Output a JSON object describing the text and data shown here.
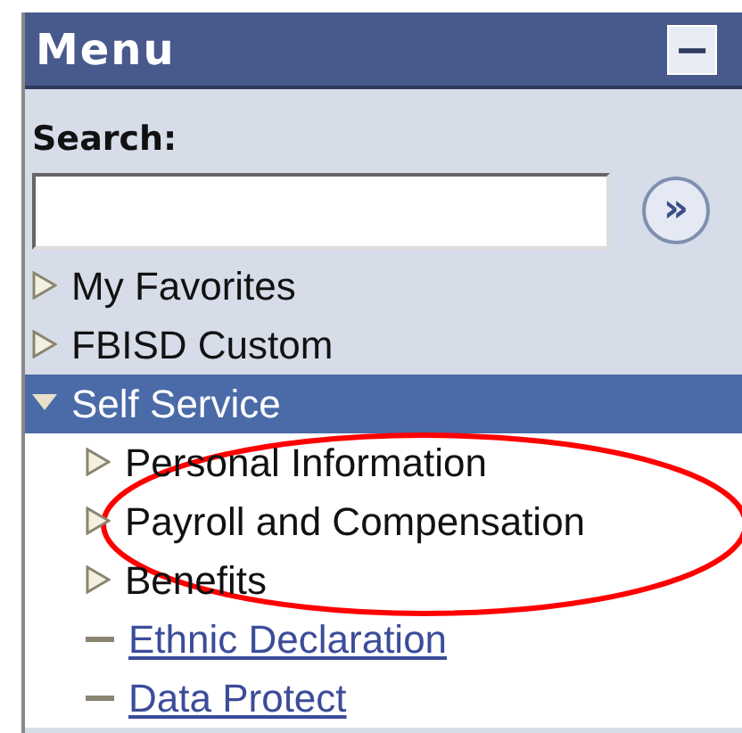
{
  "menu": {
    "title": "Menu",
    "collapse_button": "−"
  },
  "search": {
    "label": "Search:",
    "go_button": "»"
  },
  "tree": [
    {
      "label": "My Favorites",
      "kind": "folder",
      "expanded": false,
      "selected": false
    },
    {
      "label": "FBISD Custom",
      "kind": "folder",
      "expanded": false,
      "selected": false
    },
    {
      "label": "Self Service",
      "kind": "folder",
      "expanded": true,
      "selected": true,
      "children": [
        {
          "label": "Personal Information",
          "kind": "folder",
          "expanded": false,
          "selected": false
        },
        {
          "label": "Payroll and Compensation",
          "kind": "folder",
          "expanded": false,
          "selected": false
        },
        {
          "label": "Benefits",
          "kind": "folder",
          "expanded": false,
          "selected": false
        },
        {
          "label": "Ethnic Declaration",
          "kind": "link",
          "selected": false
        },
        {
          "label": "Data Protect",
          "kind": "link",
          "selected": false
        }
      ]
    }
  ],
  "callout": {
    "color": "#ff0000"
  }
}
